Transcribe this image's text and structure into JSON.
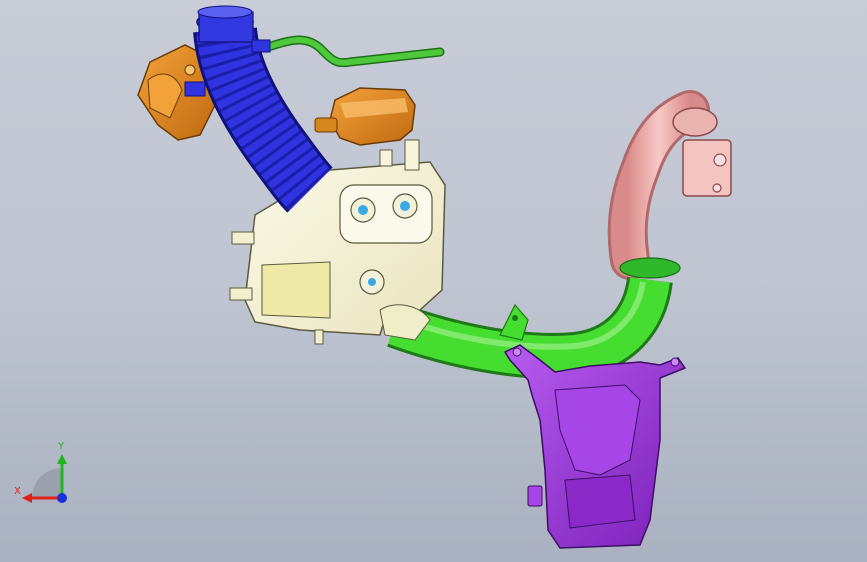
{
  "viewport": {
    "background_top": "#c7ccd7",
    "background_bottom": "#a9b0bf"
  },
  "model": {
    "parts": [
      {
        "name": "air-intake-hose",
        "color": "#2b2fd8"
      },
      {
        "name": "resonator-left",
        "color": "#e38a1d"
      },
      {
        "name": "resonator-right",
        "color": "#e38a1d"
      },
      {
        "name": "breather-tube",
        "color": "#3aa63a"
      },
      {
        "name": "air-filter-housing",
        "color": "#f2efd0"
      },
      {
        "name": "outlet-duct",
        "color": "#39d22a"
      },
      {
        "name": "elbow-pipe",
        "color": "#f2a9a8"
      },
      {
        "name": "lower-resonator-box",
        "color": "#9b35d8"
      }
    ]
  },
  "triad": {
    "x_label": "X",
    "y_label": "Y",
    "x_color": "#e0201a",
    "y_color": "#1fb61f",
    "z_color": "#1a33d8"
  }
}
